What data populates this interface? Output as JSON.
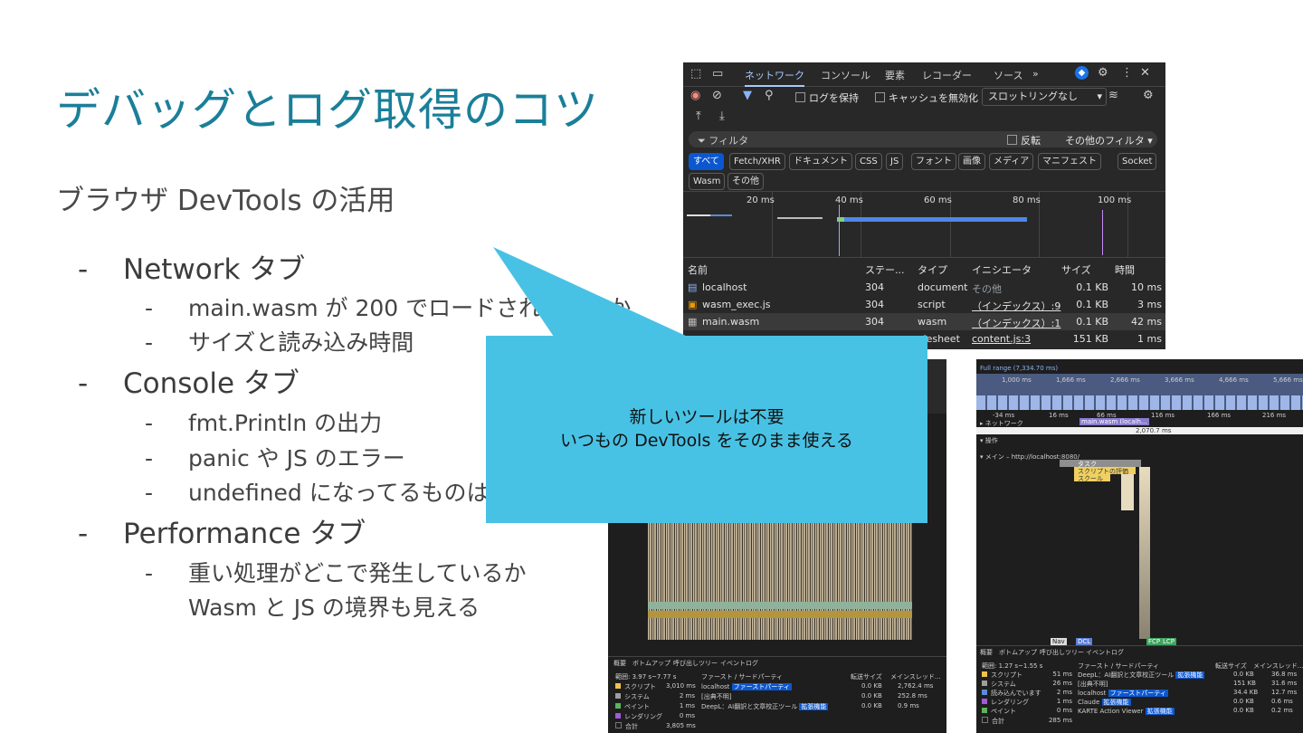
{
  "slide": {
    "title": "デバッグとログ取得のコツ",
    "subtitle": "ブラウザ DevTools の活用",
    "bullets": [
      {
        "text": "Network タブ",
        "children": [
          "main.wasm が 200 でロードされているか",
          "サイズと読み込み時間"
        ]
      },
      {
        "text": "Console タブ",
        "children": [
          "fmt.Println の出力",
          "panic や JS のエラー",
          "undefined になってるものはないか"
        ]
      },
      {
        "text": "Performance タブ",
        "children": [
          "重い処理がどこで発生しているか"
        ],
        "continuation": "Wasm と JS の境界も見える"
      }
    ],
    "dash": "-",
    "callout": {
      "line1": "新しいツールは不要",
      "line2": "いつもの DevTools をそのまま使える"
    }
  },
  "network_panel": {
    "tabs": [
      "ネットワーク",
      "コンソール",
      "要素",
      "レコーダー",
      "ソース",
      "»"
    ],
    "preserve_log": "ログを保持",
    "disable_cache": "キャッシュを無効化",
    "throttling": "スロットリングなし",
    "filter_placeholder": "フィルタ",
    "invert": "反転",
    "more_filters": "その他のフィルタ ▾",
    "type_filters": [
      "すべて",
      "Fetch/XHR",
      "ドキュメント",
      "CSS",
      "JS",
      "フォント",
      "画像",
      "メディア",
      "マニフェスト",
      "Socket",
      "Wasm",
      "その他"
    ],
    "timeline_ticks": [
      "20 ms",
      "40 ms",
      "60 ms",
      "80 ms",
      "100 ms"
    ],
    "columns": [
      "名前",
      "ステー...",
      "タイプ",
      "イニシエータ",
      "サイズ",
      "時間"
    ],
    "rows": [
      {
        "name": "localhost",
        "status": "304",
        "type": "document",
        "initiator": "その他",
        "size": "0.1 KB",
        "time": "10 ms"
      },
      {
        "name": "wasm_exec.js",
        "status": "304",
        "type": "script",
        "initiator": "（インデックス）:9",
        "size": "0.1 KB",
        "time": "3 ms"
      },
      {
        "name": "main.wasm",
        "status": "304",
        "type": "wasm",
        "initiator": "（インデックス）:1",
        "size": "0.1 KB",
        "time": "42 ms"
      },
      {
        "name": "",
        "status": "",
        "type": "ylesheet",
        "initiator": "content.js:3",
        "size": "151 KB",
        "time": "1 ms"
      }
    ]
  },
  "perf_left": {
    "bottom_tabs": [
      "概要",
      "ボトムアップ",
      "呼び出しツリー",
      "イベントログ"
    ],
    "range": "範囲: 3.97 s~7.77 s",
    "summary": [
      {
        "label": "スクリプト",
        "value": "3,010 ms",
        "color": "#f0c24c"
      },
      {
        "label": "システム",
        "value": "2 ms",
        "color": "#9e9e9e"
      },
      {
        "label": "ペイント",
        "value": "1 ms",
        "color": "#5bb45b"
      },
      {
        "label": "レンダリング",
        "value": "0 ms",
        "color": "#a15bd6"
      },
      {
        "label": "合計",
        "value": "3,805 ms",
        "color": "#1e1e1e"
      }
    ],
    "table_head": [
      "ファースト / サードパーティ",
      "転送サイズ",
      "メインスレッド..."
    ],
    "table_rows": [
      {
        "name": "localhost",
        "tag": "ファーストパーティ",
        "size": "0.0 KB",
        "time": "2,762.4 ms"
      },
      {
        "name": "[出典不明]",
        "tag": "",
        "size": "0.0 KB",
        "time": "252.8 ms"
      },
      {
        "name": "DeepL：AI翻訳と文章校正ツール",
        "tag": "拡張機能",
        "size": "0.0 KB",
        "time": "0.9 ms"
      }
    ]
  },
  "perf_right": {
    "full_range": "Full range (7,334.70 ms)",
    "ticks": [
      "1,000 ms",
      "1,666 ms",
      "2,666 ms",
      "3,666 ms",
      "4,666 ms",
      "5,666 ms"
    ],
    "timeline_ticks": [
      "-34 ms",
      "16 ms",
      "66 ms",
      "116 ms",
      "166 ms",
      "216 ms"
    ],
    "network_label": "▸ ネットワーク",
    "network_bar": "main.wasm (localh...",
    "ops_label": "▾ 操作",
    "ops_value": "2,070.7 ms",
    "main_thread": "▾ メイン – http://localhost:8080/",
    "tasks": [
      "タスク",
      "スクリプトの評価",
      "スクール"
    ],
    "markers": [
      "Nav",
      "DCL",
      "FCP",
      "LCP"
    ],
    "bottom_tabs": [
      "概要",
      "ボトムアップ",
      "呼び出しツリー",
      "イベントログ"
    ],
    "range": "範囲: 1.27 s~1.55 s",
    "summary": [
      {
        "label": "スクリプト",
        "value": "51 ms",
        "color": "#f0c24c"
      },
      {
        "label": "システム",
        "value": "26 ms",
        "color": "#9e9e9e"
      },
      {
        "label": "読み込んでいます",
        "value": "2 ms",
        "color": "#5b8bd6"
      },
      {
        "label": "レンダリング",
        "value": "1 ms",
        "color": "#a15bd6"
      },
      {
        "label": "ペイント",
        "value": "0 ms",
        "color": "#5bb45b"
      },
      {
        "label": "合計",
        "value": "285 ms",
        "color": "#1e1e1e"
      }
    ],
    "table_head": [
      "ファースト / サードパーティ",
      "転送サイズ",
      "メインスレッド..."
    ],
    "table_rows": [
      {
        "name": "DeepL：AI翻訳と文章校正ツール",
        "tag": "拡張機能",
        "size": "0.0 KB",
        "time": "36.8 ms"
      },
      {
        "name": "[出典不明]",
        "tag": "",
        "size": "151 KB",
        "time": "31.6 ms"
      },
      {
        "name": "localhost",
        "tag": "ファーストパーティ",
        "size": "34.4 KB",
        "time": "12.7 ms"
      },
      {
        "name": "Claude",
        "tag": "拡張機能",
        "size": "0.0 KB",
        "time": "0.6 ms"
      },
      {
        "name": "KARTE Action Viewer",
        "tag": "拡張機能",
        "size": "0.0 KB",
        "time": "0.2 ms"
      }
    ]
  }
}
